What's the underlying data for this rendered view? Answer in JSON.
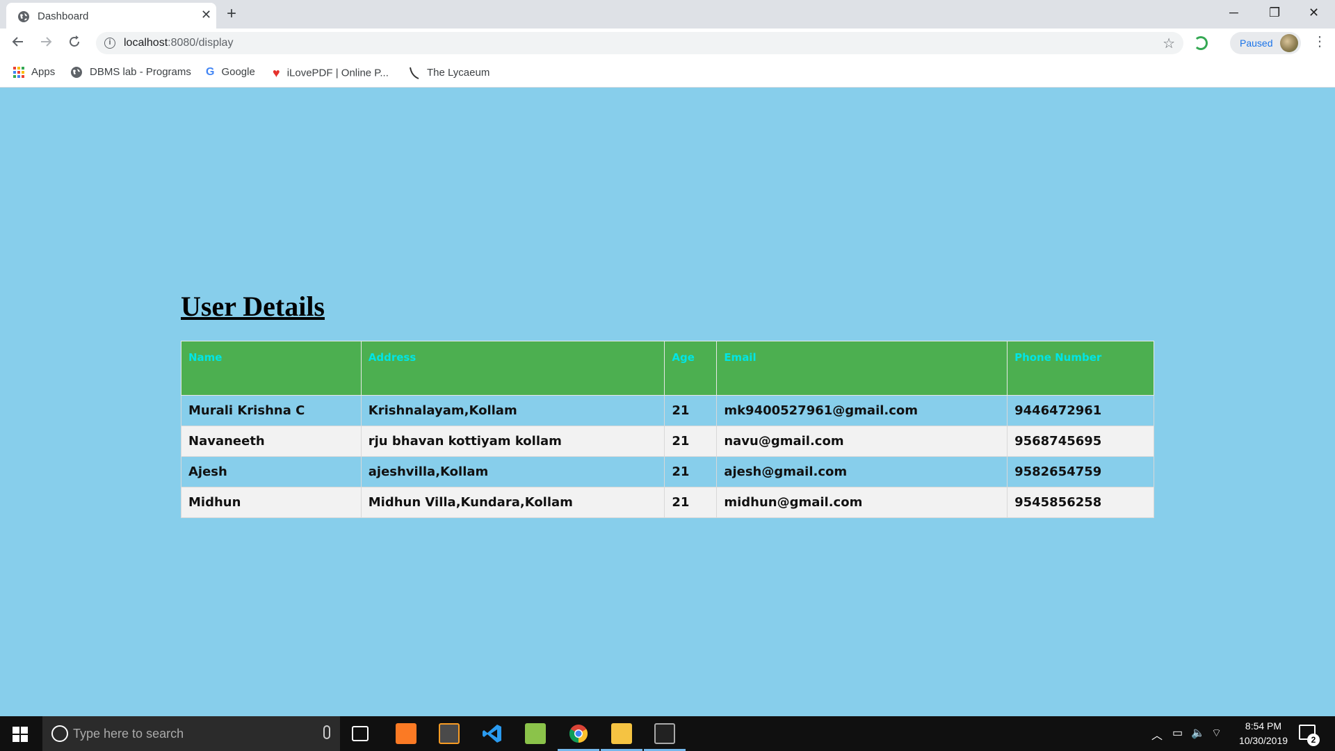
{
  "browser": {
    "tab_title": "Dashboard",
    "new_tab_glyph": "+",
    "tab_close_glyph": "✕",
    "window_controls": {
      "minimize": "─",
      "restore": "❐",
      "close": "✕"
    },
    "url_host": "localhost",
    "url_rest": ":8080/display",
    "profile_status": "Paused",
    "bookmarks": [
      {
        "label": "Apps",
        "icon": "apps-grid-icon"
      },
      {
        "label": "DBMS lab - Programs",
        "icon": "globe-icon"
      },
      {
        "label": "Google",
        "icon": "google-icon"
      },
      {
        "label": "iLovePDF | Online P...",
        "icon": "heart-icon"
      },
      {
        "label": "The Lycaeum",
        "icon": "lycaeum-icon"
      }
    ]
  },
  "page": {
    "heading": "User Details",
    "table": {
      "columns": [
        "Name",
        "Address",
        "Age",
        "Email",
        "Phone Number"
      ],
      "rows": [
        {
          "name": "Murali Krishna C",
          "address": "Krishnalayam,Kollam",
          "age": "21",
          "email": "mk9400527961@gmail.com",
          "phone": "9446472961"
        },
        {
          "name": "Navaneeth",
          "address": "rju bhavan kottiyam kollam",
          "age": "21",
          "email": "navu@gmail.com",
          "phone": "9568745695"
        },
        {
          "name": "Ajesh",
          "address": "ajeshvilla,Kollam",
          "age": "21",
          "email": "ajesh@gmail.com",
          "phone": "9582654759"
        },
        {
          "name": "Midhun",
          "address": "Midhun Villa,Kundara,Kollam",
          "age": "21",
          "email": "midhun@gmail.com",
          "phone": "9545856258"
        }
      ],
      "colors": {
        "header_bg": "#4caf50",
        "header_text": "#00e5e5",
        "row_odd": "#87ceeb",
        "row_even": "#f2f2f2"
      }
    },
    "background": "#87ceeb"
  },
  "taskbar": {
    "search_placeholder": "Type here to search",
    "apps": [
      "task-view-icon",
      "xampp-icon",
      "sublime-text-icon",
      "vscode-icon",
      "notepad-plus-icon",
      "chrome-icon",
      "file-explorer-icon",
      "terminal-icon"
    ],
    "clock_time": "8:54 PM",
    "clock_date": "10/30/2019",
    "notification_count": "2"
  }
}
